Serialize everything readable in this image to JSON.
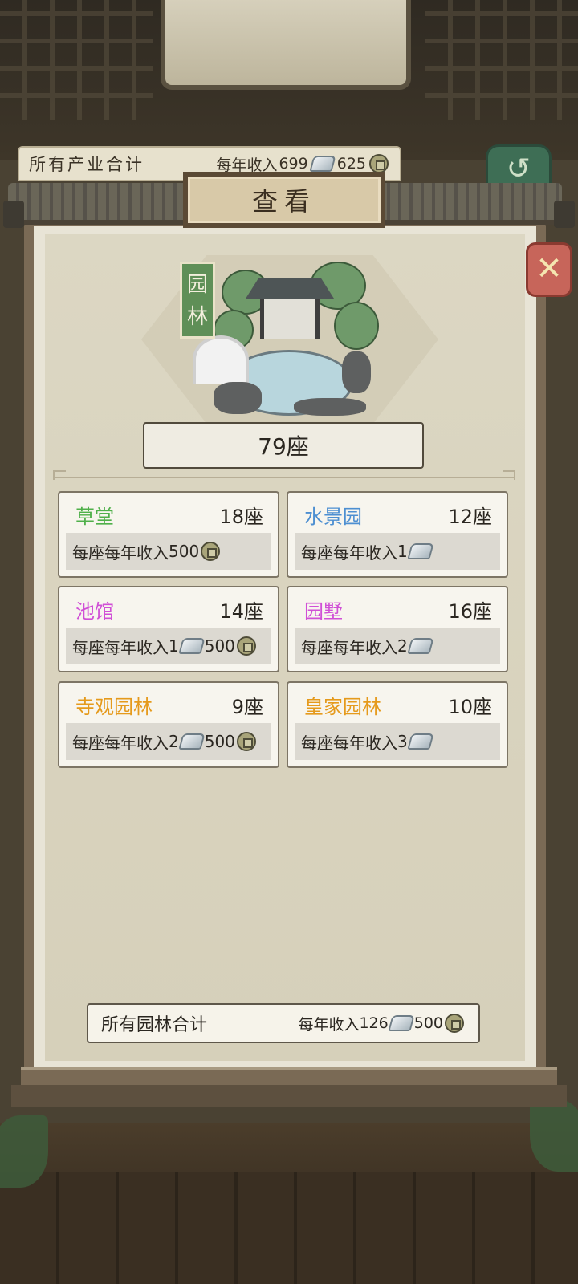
{
  "summary": {
    "label": "所有产业合计",
    "income_prefix": "每年收入",
    "silver": "699",
    "coins": "625"
  },
  "title": "查看",
  "category": {
    "tag": "园林",
    "count": "79座"
  },
  "cards": [
    {
      "name": "草堂",
      "count": "18座",
      "income_text": "每座每年收入",
      "silver": "",
      "coins": "500",
      "color": "#4fb04a"
    },
    {
      "name": "水景园",
      "count": "12座",
      "income_text": "每座每年收入",
      "silver": "1",
      "coins": "",
      "color": "#4d8fd1"
    },
    {
      "name": "池馆",
      "count": "14座",
      "income_text": "每座每年收入",
      "silver": "1",
      "coins": "500",
      "color": "#d04fd6"
    },
    {
      "name": "园墅",
      "count": "16座",
      "income_text": "每座每年收入",
      "silver": "2",
      "coins": "",
      "color": "#d04fd6"
    },
    {
      "name": "寺观园林",
      "count": "9座",
      "income_text": "每座每年收入",
      "silver": "2",
      "coins": "500",
      "color": "#e59a1c"
    },
    {
      "name": "皇家园林",
      "count": "10座",
      "income_text": "每座每年收入",
      "silver": "3",
      "coins": "",
      "color": "#e59a1c"
    }
  ],
  "total": {
    "label": "所有园林合计",
    "income_prefix": "每年收入",
    "silver": "126",
    "coins": "500"
  },
  "icons": {
    "silver": "silver-ingot-icon",
    "coin": "copper-coin-icon",
    "back": "back-arrow-icon",
    "close": "close-icon"
  }
}
